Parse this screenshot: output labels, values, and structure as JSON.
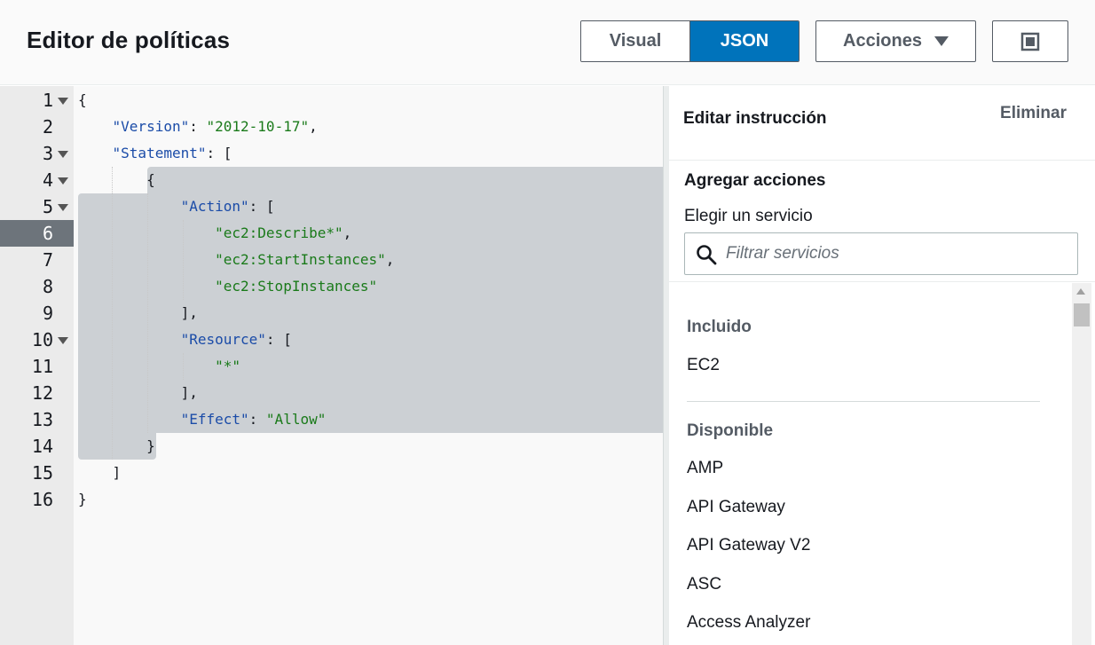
{
  "header": {
    "title": "Editor de políticas",
    "tab_visual": "Visual",
    "tab_json": "JSON",
    "actions_label": "Acciones"
  },
  "editor": {
    "line_numbers": [
      "1",
      "2",
      "3",
      "4",
      "5",
      "6",
      "7",
      "8",
      "9",
      "10",
      "11",
      "12",
      "13",
      "14",
      "15",
      "16"
    ],
    "active_line": 6,
    "lines": [
      {
        "t": "{"
      },
      {
        "k": "\"Version\"",
        "s": "\"2012-10-17\"",
        "e": ","
      },
      {
        "k": "\"Statement\"",
        "e": "["
      },
      {
        "t": "{"
      },
      {
        "k": "\"Action\"",
        "e": "["
      },
      {
        "s": "\"ec2:Describe*\"",
        "e": ","
      },
      {
        "s": "\"ec2:StartInstances\"",
        "e": ","
      },
      {
        "s": "\"ec2:StopInstances\""
      },
      {
        "t": "],"
      },
      {
        "k": "\"Resource\"",
        "e": "["
      },
      {
        "s": "\"*\""
      },
      {
        "t": "],"
      },
      {
        "k": "\"Effect\"",
        "s": "\"Allow\""
      },
      {
        "t": "}"
      },
      {
        "t": "]"
      },
      {
        "t": "}"
      }
    ]
  },
  "panel": {
    "title": "Editar instrucción",
    "delete_label": "Eliminar",
    "section_title": "Agregar acciones",
    "service_label": "Elegir un servicio",
    "search_placeholder": "Filtrar servicios",
    "included_label": "Incluido",
    "included": [
      "EC2"
    ],
    "available_label": "Disponible",
    "available": [
      "AMP",
      "API Gateway",
      "API Gateway V2",
      "ASC",
      "Access Analyzer"
    ]
  }
}
